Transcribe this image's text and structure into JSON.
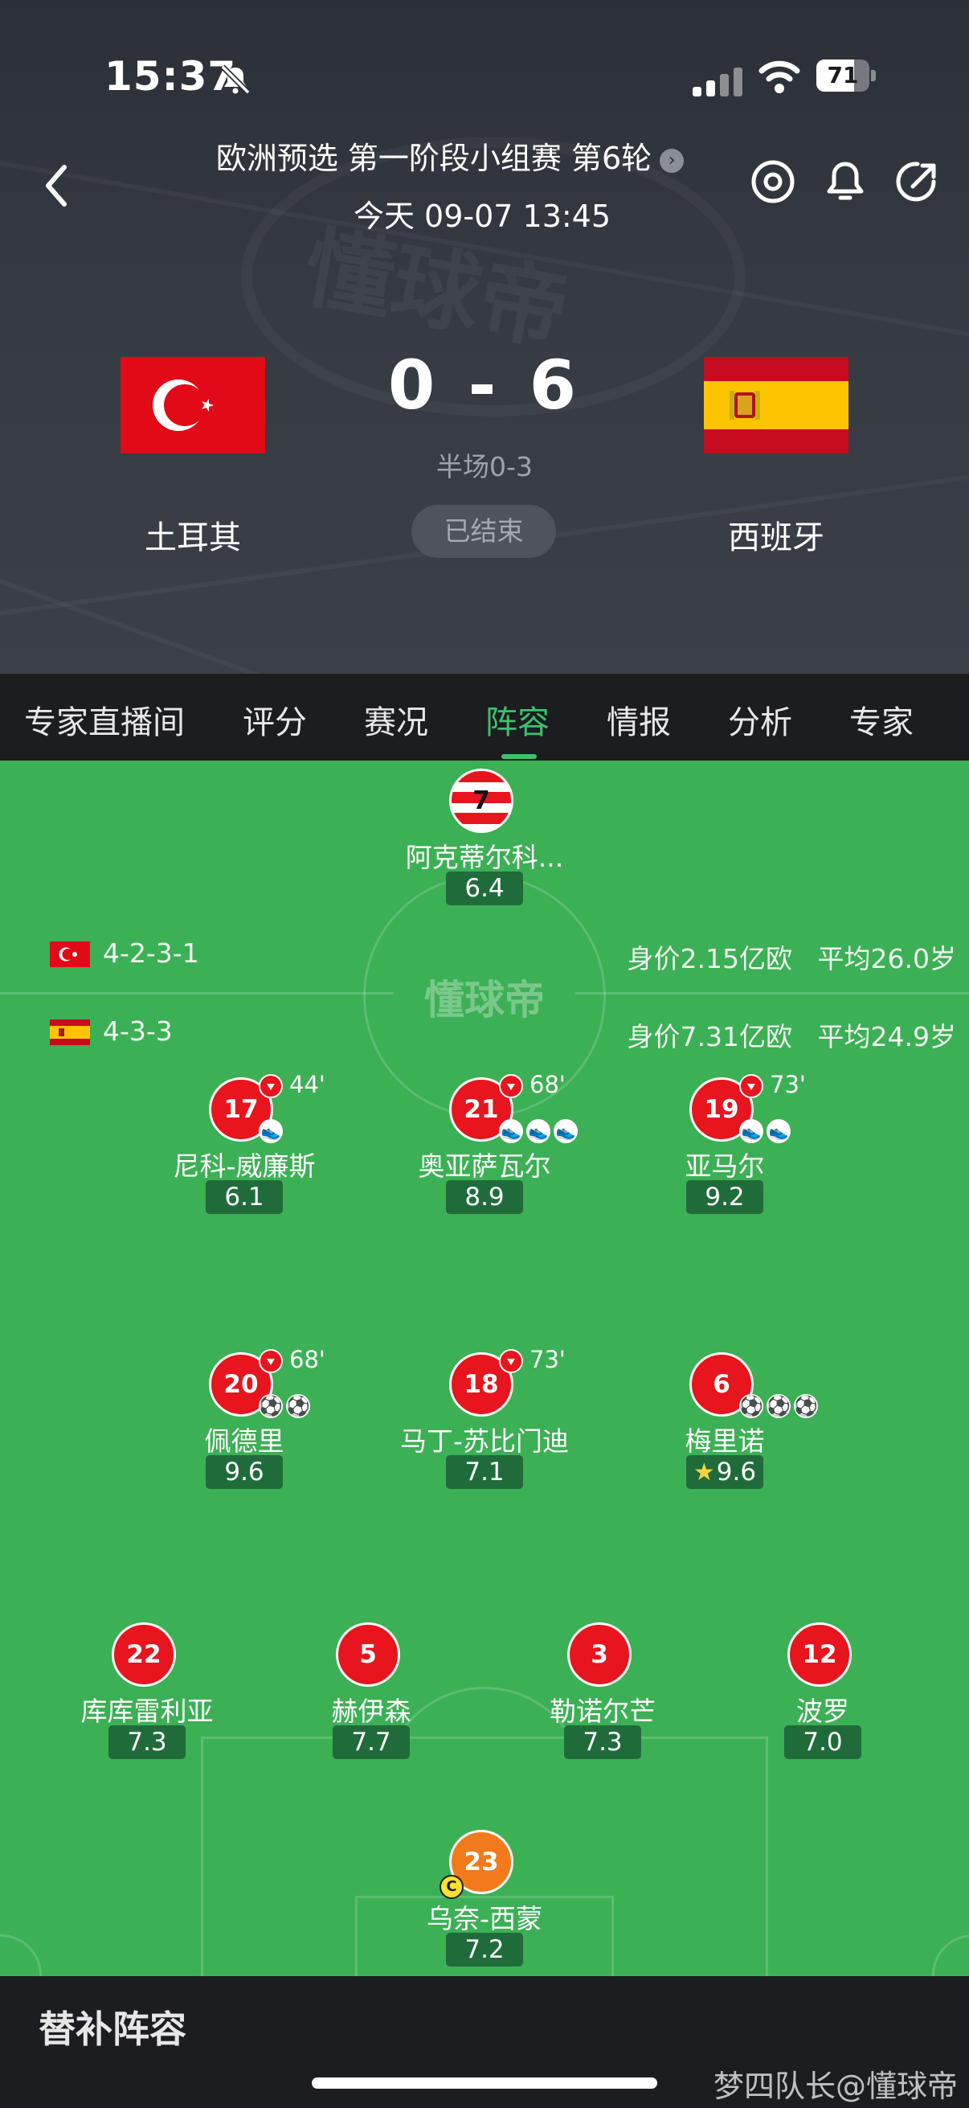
{
  "status_bar": {
    "time": "15:37",
    "battery": "71",
    "battery_level": 0.71
  },
  "header": {
    "competition": "欧洲预选 第一阶段小组赛 第6轮",
    "match_time": "今天 09-07 13:45",
    "watermark": "懂球帝",
    "home": {
      "name": "土耳其"
    },
    "away": {
      "name": "西班牙"
    },
    "score": "0 - 6",
    "halftime": "半场0-3",
    "status": "已结束"
  },
  "tabs": [
    {
      "label": "专家直播间"
    },
    {
      "label": "评分"
    },
    {
      "label": "赛况"
    },
    {
      "label": "阵容"
    },
    {
      "label": "情报"
    },
    {
      "label": "分析"
    },
    {
      "label": "专家"
    }
  ],
  "pitch": {
    "logo": "懂球帝",
    "home_formation": {
      "formation": "4-2-3-1",
      "value": "身价2.15亿欧",
      "avg_age": "平均26.0岁"
    },
    "away_formation": {
      "formation": "4-3-3",
      "value": "身价7.31亿欧",
      "avg_age": "平均24.9岁"
    },
    "home_players": [
      {
        "number": "7",
        "name": "阿克蒂尔科...",
        "rating": "6.4"
      }
    ],
    "away_players": [
      {
        "number": "17",
        "name": "尼科-威廉斯",
        "rating": "6.1",
        "sub_minute": "44'",
        "events": [
          "boot"
        ]
      },
      {
        "number": "21",
        "name": "奥亚萨瓦尔",
        "rating": "8.9",
        "sub_minute": "68'",
        "events": [
          "boot",
          "boot",
          "boot"
        ]
      },
      {
        "number": "19",
        "name": "亚马尔",
        "rating": "9.2",
        "sub_minute": "73'",
        "events": [
          "boot",
          "boot"
        ]
      },
      {
        "number": "20",
        "name": "佩德里",
        "rating": "9.6",
        "sub_minute": "68'",
        "events": [
          "goal",
          "goal"
        ]
      },
      {
        "number": "18",
        "name": "马丁-苏比门迪",
        "rating": "7.1",
        "sub_minute": "73'",
        "events": []
      },
      {
        "number": "6",
        "name": "梅里诺",
        "rating": "9.6",
        "events": [
          "goal",
          "goal",
          "goal"
        ],
        "mvp": true
      },
      {
        "number": "22",
        "name": "库库雷利亚",
        "rating": "7.3"
      },
      {
        "number": "5",
        "name": "赫伊森",
        "rating": "7.7"
      },
      {
        "number": "3",
        "name": "勒诺尔芒",
        "rating": "7.3"
      },
      {
        "number": "12",
        "name": "波罗",
        "rating": "7.0"
      },
      {
        "number": "23",
        "name": "乌奈-西蒙",
        "rating": "7.2",
        "captain": "C",
        "goalkeeper": true
      }
    ]
  },
  "bottom": {
    "subs_title": "替补阵容",
    "watermark": "梦四队长@懂球帝"
  }
}
